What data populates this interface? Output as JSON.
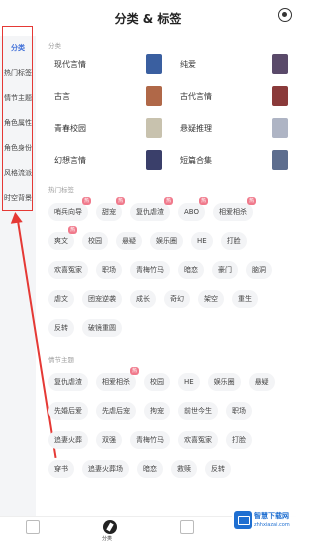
{
  "header": {
    "title": "分类 & 标签"
  },
  "sidebar": {
    "items": [
      {
        "label": "分类",
        "active": true
      },
      {
        "label": "热门标签"
      },
      {
        "label": "情节主题"
      },
      {
        "label": "角色属性"
      },
      {
        "label": "角色身份"
      },
      {
        "label": "风格流派"
      },
      {
        "label": "时空背景"
      }
    ]
  },
  "categories": {
    "section_title": "分类",
    "items": [
      {
        "label": "现代言情",
        "thumb_color": "#3a5fa0"
      },
      {
        "label": "纯爱",
        "thumb_color": "#5a4a6a"
      },
      {
        "label": "古言",
        "thumb_color": "#b06848"
      },
      {
        "label": "古代言情",
        "thumb_color": "#8a3a3a"
      },
      {
        "label": "青春校园",
        "thumb_color": "#c8c2ae"
      },
      {
        "label": "悬疑推理",
        "thumb_color": "#aeb4c4"
      },
      {
        "label": "幻想言情",
        "thumb_color": "#3a3f6a"
      },
      {
        "label": "短篇合集",
        "thumb_color": "#5d6d8e"
      }
    ]
  },
  "hot_tags": {
    "section_title": "热门标签",
    "rows": [
      [
        {
          "label": "哨兵向导",
          "badge": "热"
        },
        {
          "label": "甜宠",
          "badge": "热"
        },
        {
          "label": "复仇虐渣",
          "badge": "热"
        },
        {
          "label": "ABO",
          "badge": "热"
        },
        {
          "label": "相爱相杀",
          "badge": "热"
        }
      ],
      [
        {
          "label": "爽文",
          "badge": "热"
        },
        {
          "label": "校园"
        },
        {
          "label": "悬疑"
        },
        {
          "label": "娱乐圈"
        },
        {
          "label": "HE"
        },
        {
          "label": "打脸"
        }
      ],
      [
        {
          "label": "欢喜冤家"
        },
        {
          "label": "职场"
        },
        {
          "label": "青梅竹马"
        },
        {
          "label": "暗恋"
        },
        {
          "label": "豪门"
        },
        {
          "label": "脑洞"
        }
      ],
      [
        {
          "label": "虐文"
        },
        {
          "label": "团宠逆袭"
        },
        {
          "label": "成长"
        },
        {
          "label": "奇幻"
        },
        {
          "label": "架空"
        },
        {
          "label": "重生"
        }
      ],
      [
        {
          "label": "反转"
        },
        {
          "label": "破镜重圆"
        }
      ]
    ]
  },
  "plot_tags": {
    "section_title": "情节主题",
    "rows": [
      [
        {
          "label": "复仇虐渣"
        },
        {
          "label": "相爱相杀",
          "badge": "热"
        },
        {
          "label": "校园"
        },
        {
          "label": "HE"
        },
        {
          "label": "娱乐圈"
        },
        {
          "label": "悬疑"
        }
      ],
      [
        {
          "label": "先婚后爱"
        },
        {
          "label": "先虐后宠"
        },
        {
          "label": "拘宠"
        },
        {
          "label": "前世今生"
        },
        {
          "label": "职场"
        }
      ],
      [
        {
          "label": "追妻火葬"
        },
        {
          "label": "双强"
        },
        {
          "label": "青梅竹马"
        },
        {
          "label": "欢喜冤家"
        },
        {
          "label": "打脸"
        }
      ],
      [
        {
          "label": "穿书"
        },
        {
          "label": "追妻火葬场"
        },
        {
          "label": "暗恋"
        },
        {
          "label": "救赎"
        },
        {
          "label": "反转"
        }
      ]
    ]
  },
  "tabbar": {
    "middle_label": "分类"
  },
  "watermark": {
    "name": "智慧下载网",
    "url": "zhhxiazai.com"
  }
}
